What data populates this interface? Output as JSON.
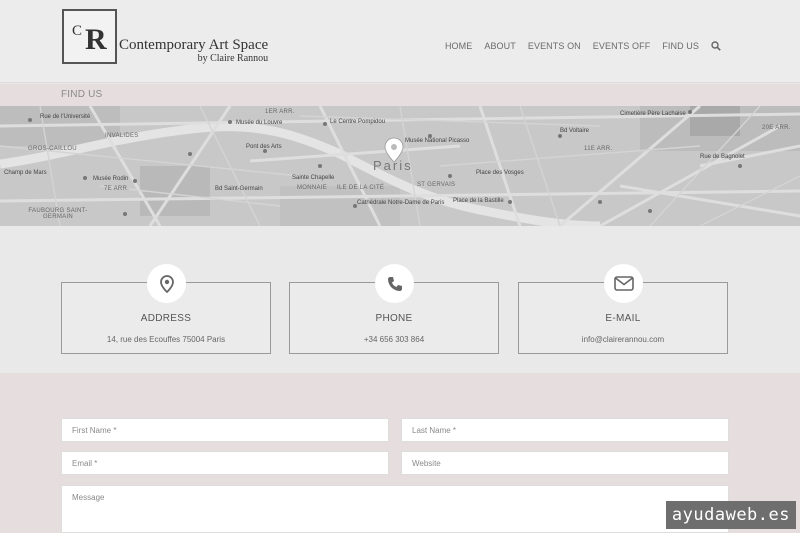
{
  "header": {
    "logo_c": "C",
    "logo_r": "R",
    "logo_title": "Contemporary Art Space",
    "logo_sub": "by Claire Rannou",
    "nav": [
      "HOME",
      "ABOUT",
      "EVENTS ON",
      "EVENTS OFF",
      "FIND US"
    ]
  },
  "section": {
    "title": "FIND US"
  },
  "map": {
    "city": "Paris",
    "labels": [
      {
        "t": "Rue de l'Université"
      },
      {
        "t": "Musée du Louvre"
      },
      {
        "t": "Le Centre Pompidou"
      },
      {
        "t": "Musée National Picasso"
      },
      {
        "t": "Pont des Arts"
      },
      {
        "t": "Sainte Chapelle"
      },
      {
        "t": "Musée Rodin"
      },
      {
        "t": "Champ de Mars"
      },
      {
        "t": "Cathédrale Notre-Dame de Paris"
      },
      {
        "t": "Place de la Bastille"
      },
      {
        "t": "Place des Vosges"
      },
      {
        "t": "Cimetière Père Lachaise"
      },
      {
        "t": "Bd Saint-Germain"
      },
      {
        "t": "Bd Voltaire"
      },
      {
        "t": "Rue de Bagnolet"
      }
    ],
    "districts": [
      {
        "t": "1ER ARR."
      },
      {
        "t": "INVALIDES"
      },
      {
        "t": "GROS-CAILLOU"
      },
      {
        "t": "7E ARR."
      },
      {
        "t": "MONNAIE"
      },
      {
        "t": "ILE DE LA CITÉ"
      },
      {
        "t": "ST GERVAIS"
      },
      {
        "t": "11E ARR."
      },
      {
        "t": "20E ARR."
      },
      {
        "t": "FAUBOURG SAINT-GERMAIN"
      }
    ]
  },
  "cards": [
    {
      "title": "ADDRESS",
      "value": "14, rue des Ecouffes 75004 Paris"
    },
    {
      "title": "PHONE",
      "value": "+34 656 303 864"
    },
    {
      "title": "E-MAIL",
      "value": "info@clairerannou.com"
    }
  ],
  "form": {
    "first_name": "First Name *",
    "last_name": "Last Name *",
    "email": "Email *",
    "website": "Website",
    "message": "Message"
  },
  "watermark": "ayudaweb.es",
  "colors": {
    "header_bg": "#ececec",
    "band_bg": "#e6dede",
    "map_bg": "#c9c9c9"
  }
}
